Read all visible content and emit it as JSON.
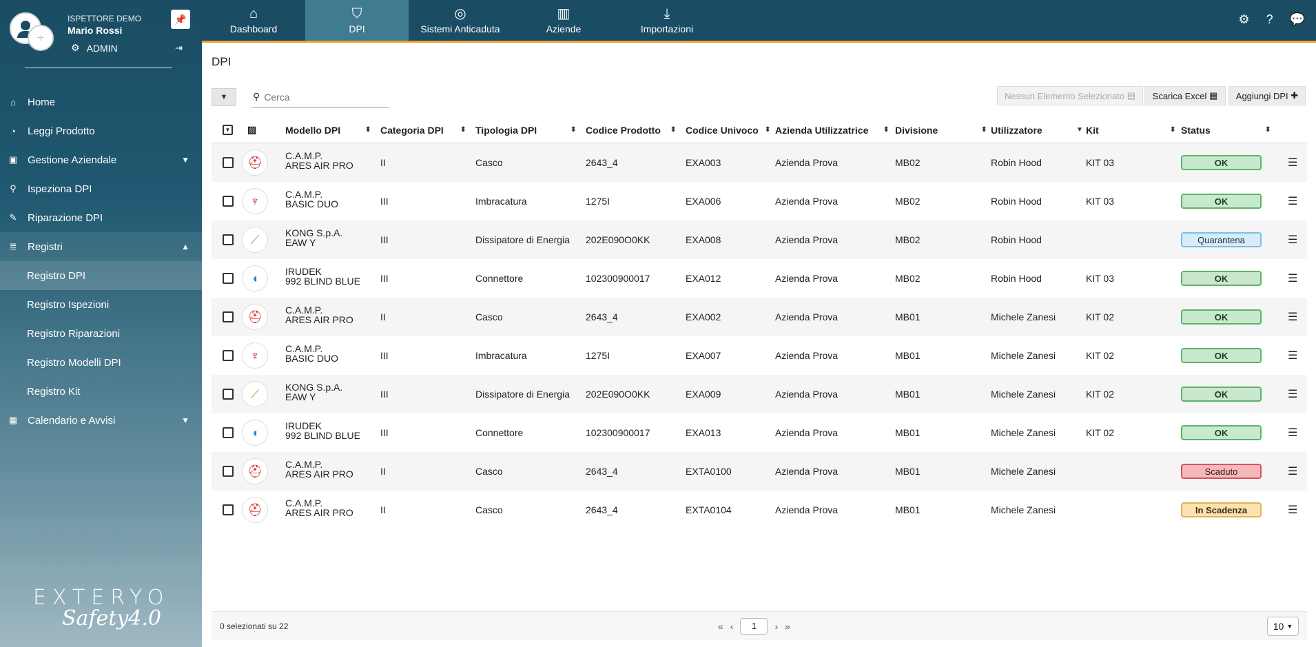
{
  "user": {
    "role": "ISPETTORE DEMO",
    "name": "Mario Rossi",
    "badge": "ADMIN",
    "logo_text": "~|~"
  },
  "sidebar": {
    "items": [
      {
        "label": "Home",
        "icon": "home-icon"
      },
      {
        "label": "Leggi Prodotto",
        "icon": "rss-icon"
      },
      {
        "label": "Gestione Aziendale",
        "icon": "briefcase-icon"
      },
      {
        "label": "Ispeziona DPI",
        "icon": "search-icon"
      },
      {
        "label": "Riparazione DPI",
        "icon": "wrench-icon"
      },
      {
        "label": "Registri",
        "icon": "database-icon"
      },
      {
        "label": "Calendario e Avvisi",
        "icon": "calendar-icon"
      }
    ],
    "sub_items": [
      "Registro DPI",
      "Registro Ispezioni",
      "Registro Riparazioni",
      "Registro Modelli DPI",
      "Registro Kit"
    ]
  },
  "brand": {
    "top": "EXTERYO",
    "bottom": "Safety4.0"
  },
  "topnav": {
    "tabs": [
      {
        "label": "Dashboard",
        "icon": "home-icon"
      },
      {
        "label": "DPI",
        "icon": "shield-icon"
      },
      {
        "label": "Sistemi Anticaduta",
        "icon": "lifebuoy-icon"
      },
      {
        "label": "Aziende",
        "icon": "building-icon"
      },
      {
        "label": "Importazioni",
        "icon": "download-icon"
      }
    ]
  },
  "page": {
    "title": "DPI"
  },
  "toolbar": {
    "search_placeholder": "Cerca",
    "none_selected": "Nessun Elemento Selezionato",
    "export_excel": "Scarica Excel",
    "add_dpi": "Aggiungi DPI"
  },
  "table": {
    "columns": [
      "Modello DPI",
      "Categoria DPI",
      "Tipologia DPI",
      "Codice Prodotto",
      "Codice Univoco",
      "Azienda Utilizzatrice",
      "Divisione",
      "Utilizzatore",
      "Kit",
      "Status"
    ],
    "rows": [
      {
        "brand": "C.A.M.P.",
        "model": "ARES AIR PRO",
        "cat": "II",
        "tipo": "Casco",
        "codprod": "2643_4",
        "coduni": "EXA003",
        "azienda": "Azienda Prova",
        "div": "MB02",
        "user": "Robin Hood",
        "kit": "KIT 03",
        "status": "OK",
        "img": "helmet"
      },
      {
        "brand": "C.A.M.P.",
        "model": "BASIC DUO",
        "cat": "III",
        "tipo": "Imbracatura",
        "codprod": "1275I",
        "coduni": "EXA006",
        "azienda": "Azienda Prova",
        "div": "MB02",
        "user": "Robin Hood",
        "kit": "KIT 03",
        "status": "OK",
        "img": "harness"
      },
      {
        "brand": "KONG S.p.A.",
        "model": "EAW Y",
        "cat": "III",
        "tipo": "Dissipatore di Energia",
        "codprod": "202E090O0KK",
        "coduni": "EXA008",
        "azienda": "Azienda Prova",
        "div": "MB02",
        "user": "Robin Hood",
        "kit": "",
        "status": "Quarantena",
        "img": "lanyard"
      },
      {
        "brand": "IRUDEK",
        "model": "992 BLIND BLUE",
        "cat": "III",
        "tipo": "Connettore",
        "codprod": "102300900017",
        "coduni": "EXA012",
        "azienda": "Azienda Prova",
        "div": "MB02",
        "user": "Robin Hood",
        "kit": "KIT 03",
        "status": "OK",
        "img": "carabiner"
      },
      {
        "brand": "C.A.M.P.",
        "model": "ARES AIR PRO",
        "cat": "II",
        "tipo": "Casco",
        "codprod": "2643_4",
        "coduni": "EXA002",
        "azienda": "Azienda Prova",
        "div": "MB01",
        "user": "Michele Zanesi",
        "kit": "KIT 02",
        "status": "OK",
        "img": "helmet"
      },
      {
        "brand": "C.A.M.P.",
        "model": "BASIC DUO",
        "cat": "III",
        "tipo": "Imbracatura",
        "codprod": "1275I",
        "coduni": "EXA007",
        "azienda": "Azienda Prova",
        "div": "MB01",
        "user": "Michele Zanesi",
        "kit": "KIT 02",
        "status": "OK",
        "img": "harness"
      },
      {
        "brand": "KONG S.p.A.",
        "model": "EAW Y",
        "cat": "III",
        "tipo": "Dissipatore di Energia",
        "codprod": "202E090O0KK",
        "coduni": "EXA009",
        "azienda": "Azienda Prova",
        "div": "MB01",
        "user": "Michele Zanesi",
        "kit": "KIT 02",
        "status": "OK",
        "img": "lanyard"
      },
      {
        "brand": "IRUDEK",
        "model": "992 BLIND BLUE",
        "cat": "III",
        "tipo": "Connettore",
        "codprod": "102300900017",
        "coduni": "EXA013",
        "azienda": "Azienda Prova",
        "div": "MB01",
        "user": "Michele Zanesi",
        "kit": "KIT 02",
        "status": "OK",
        "img": "carabiner"
      },
      {
        "brand": "C.A.M.P.",
        "model": "ARES AIR PRO",
        "cat": "II",
        "tipo": "Casco",
        "codprod": "2643_4",
        "coduni": "EXTA0100",
        "azienda": "Azienda Prova",
        "div": "MB01",
        "user": "Michele Zanesi",
        "kit": "",
        "status": "Scaduto",
        "img": "helmet"
      },
      {
        "brand": "C.A.M.P.",
        "model": "ARES AIR PRO",
        "cat": "II",
        "tipo": "Casco",
        "codprod": "2643_4",
        "coduni": "EXTA0104",
        "azienda": "Azienda Prova",
        "div": "MB01",
        "user": "Michele Zanesi",
        "kit": "",
        "status": "In Scadenza",
        "img": "helmet"
      }
    ]
  },
  "footer": {
    "selection": "0 selezionati su 22",
    "page": "1",
    "page_size": "10"
  },
  "colors": {
    "primary": "#1a4d63",
    "active_tab": "#3f7b91",
    "accent": "#f0a030"
  }
}
